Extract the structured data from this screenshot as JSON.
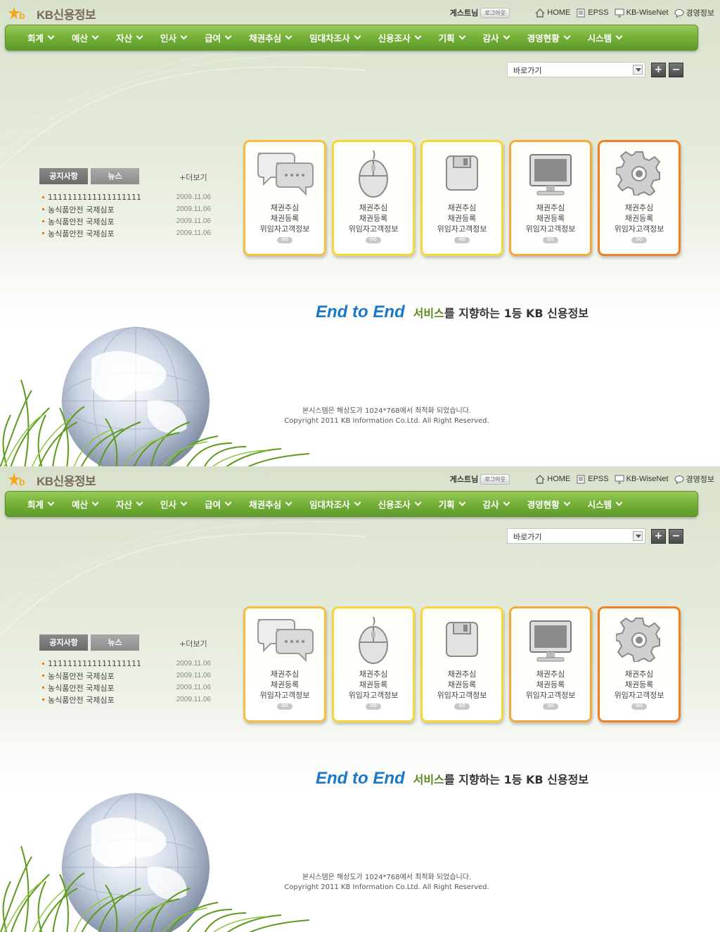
{
  "brand": {
    "logo_text": "KB신용정보"
  },
  "topbar": {
    "guest_label": "게스트님",
    "logout_label": "로그아웃",
    "links": [
      {
        "label": "HOME",
        "icon": "home-icon"
      },
      {
        "label": "EPSS",
        "icon": "document-icon"
      },
      {
        "label": "KB-WiseNet",
        "icon": "monitor-icon"
      },
      {
        "label": "경영정보",
        "icon": "chat-icon"
      }
    ]
  },
  "gnb": {
    "items": [
      "회계",
      "예산",
      "자산",
      "인사",
      "급여",
      "채권추심",
      "임대차조사",
      "신용조사",
      "기획",
      "감사",
      "경영현황",
      "시스템"
    ]
  },
  "quick": {
    "label": "바로가기",
    "zoom_in": "+",
    "zoom_out": "−"
  },
  "board": {
    "tabs": [
      "공지사항",
      "뉴스"
    ],
    "more_label": "+더보기",
    "notices": [
      {
        "title": "1111111111111111111",
        "date": "2009.11.06"
      },
      {
        "title": "농식품안전 국제심포",
        "date": "2009.11.06"
      },
      {
        "title": "농식품안전 국제심포",
        "date": "2009.11.06"
      },
      {
        "title": "농식품안전 국제심포",
        "date": "2009.11.06"
      }
    ]
  },
  "cards": [
    {
      "icon": "speech-bubbles-icon",
      "lines": [
        "채권추심",
        "채권등록",
        "위임자고객정보"
      ],
      "go": "GO"
    },
    {
      "icon": "mouse-icon",
      "lines": [
        "채권추심",
        "채권등록",
        "위임자고객정보"
      ],
      "go": "GO"
    },
    {
      "icon": "floppy-disk-icon",
      "lines": [
        "채권추심",
        "채권등록",
        "위임자고객정보"
      ],
      "go": "GO"
    },
    {
      "icon": "monitor-icon",
      "lines": [
        "채권추심",
        "채권등록",
        "위임자고객정보"
      ],
      "go": "GO"
    },
    {
      "icon": "gear-icon",
      "lines": [
        "채권추심",
        "채권등록",
        "위임자고객정보"
      ],
      "go": "GO"
    }
  ],
  "slogan": {
    "e2e": "End to End",
    "service": "서비스",
    "rest": "를 지향하는 1등 KB 신용정보"
  },
  "footer": {
    "line1": "본시스템은 해상도가 1024*768에서 최적화 되었습니다.",
    "line2": "Copyright 2011 KB Information Co.Ltd. All Right Reserved."
  }
}
